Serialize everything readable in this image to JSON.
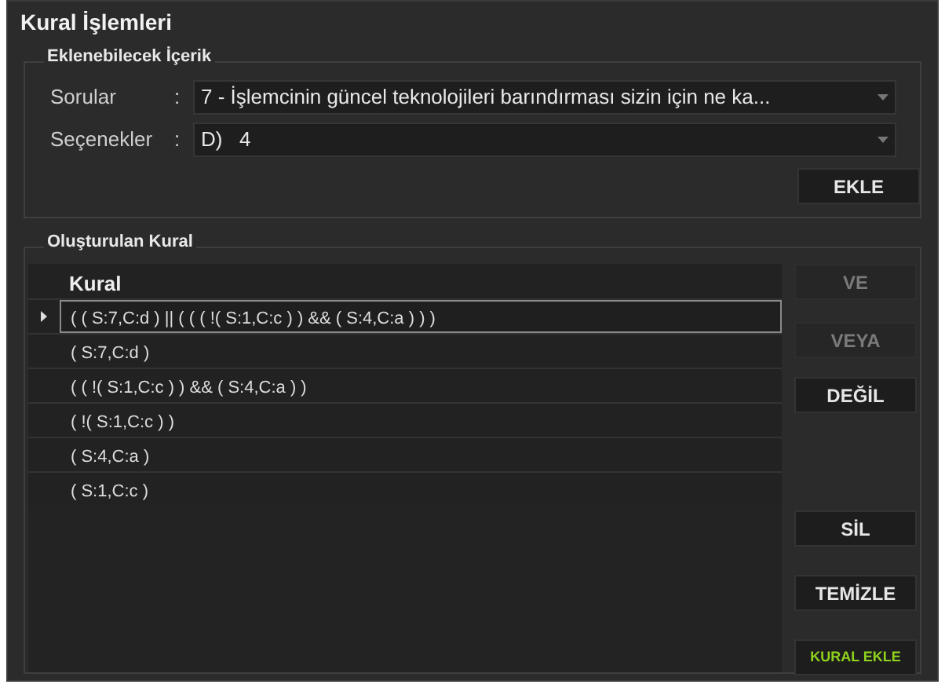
{
  "panel": {
    "title": "Kural İşlemleri"
  },
  "content_group": {
    "title": "Eklenebilecek İçerik",
    "fields": [
      {
        "label": "Sorular",
        "separator": ":",
        "value": "7 - İşlemcinin güncel teknolojileri barındırması sizin için ne ka..."
      },
      {
        "label": "Seçenekler",
        "separator": ":",
        "value": "D)   4"
      }
    ],
    "add_button": {
      "label": "EKLE"
    }
  },
  "rule_group": {
    "title": "Oluşturulan Kural",
    "table": {
      "columns": [
        "Kural"
      ],
      "rows": [
        {
          "cells": [
            "( ( S:7,C:d ) || ( ( ( !( S:1,C:c ) ) && ( S:4,C:a ) ) )"
          ],
          "selected": true
        },
        {
          "cells": [
            "( S:7,C:d )"
          ],
          "selected": false
        },
        {
          "cells": [
            "( ( !( S:1,C:c ) ) && ( S:4,C:a ) )"
          ],
          "selected": false
        },
        {
          "cells": [
            "( !( S:1,C:c ) )"
          ],
          "selected": false
        },
        {
          "cells": [
            "( S:4,C:a )"
          ],
          "selected": false
        },
        {
          "cells": [
            "( S:1,C:c )"
          ],
          "selected": false
        }
      ]
    },
    "buttons": [
      {
        "label": "VE",
        "disabled": true,
        "kind": "normal"
      },
      {
        "label": "VEYA",
        "disabled": true,
        "kind": "normal"
      },
      {
        "label": "DEĞİL",
        "disabled": false,
        "kind": "normal"
      },
      {
        "label": "SİL",
        "disabled": false,
        "kind": "normal"
      },
      {
        "label": "TEMİZLE",
        "disabled": false,
        "kind": "normal"
      },
      {
        "label": "KURAL EKLE",
        "disabled": false,
        "kind": "accent"
      }
    ]
  }
}
